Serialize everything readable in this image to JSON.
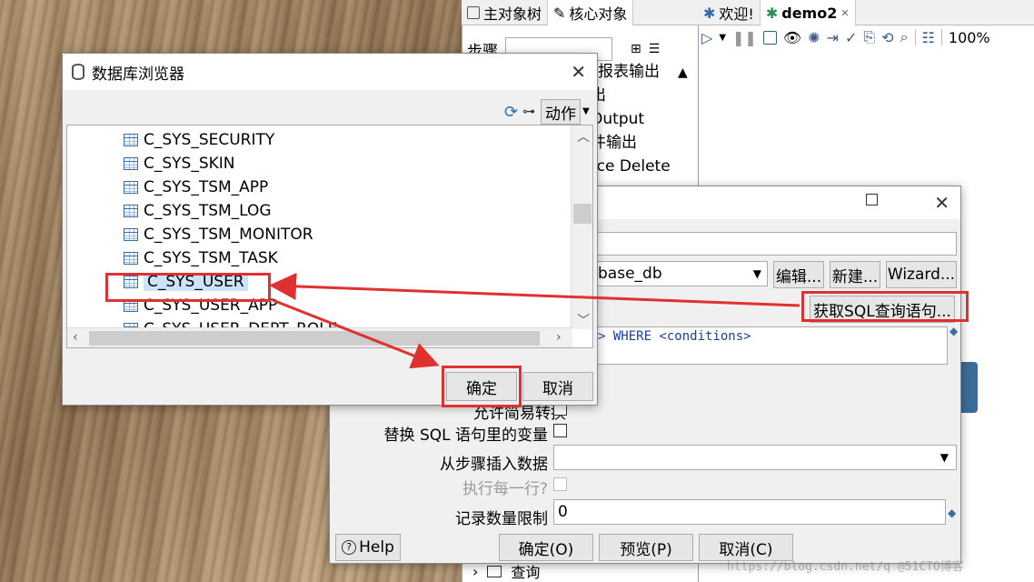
{
  "app": {
    "left_tabs": [
      "主对象树",
      "核心对象"
    ],
    "right_tabs": [
      "欢迎!",
      "demo2"
    ],
    "zoom": "100%",
    "steps_label": "步骤",
    "tree_items": [
      "报表输出",
      "出",
      "Output",
      "件输出",
      "rce Delete"
    ],
    "bottom_item": "查询"
  },
  "browser": {
    "title": "数据库浏览器",
    "action_button": "动作",
    "items": [
      "C_SYS_SECURITY",
      "C_SYS_SKIN",
      "C_SYS_TSM_APP",
      "C_SYS_TSM_LOG",
      "C_SYS_TSM_MONITOR",
      "C_SYS_TSM_TASK",
      "C_SYS_USER",
      "C_SYS_USER_APP",
      "C_SYS_USER_DEPT_ROLE"
    ],
    "selected_index": 6,
    "ok": "确定",
    "cancel": "取消"
  },
  "sql_dialog": {
    "connection_value": "base_db",
    "edit_button": "编辑...",
    "new_button": "新建...",
    "wizard_button": "Wizard...",
    "get_sql_button": "获取SQL查询语句...",
    "sql_text": "> WHERE <conditions>",
    "lazy_conversion_label": "允许简易转换",
    "replace_vars_label": "替换 SQL 语句里的变量",
    "insert_from_step_label": "从步骤插入数据",
    "execute_each_row_label": "执行每一行?",
    "limit_label": "记录数量限制",
    "limit_value": "0",
    "help_button": "Help",
    "ok_button": "确定(O)",
    "preview_button": "预览(P)",
    "cancel_button": "取消(C)"
  },
  "watermark": "https://blog.csdn.net/q @51CTO博客",
  "colors": {
    "annotation": "#e03030",
    "selection": "#cce4f7",
    "accent_green": "#2e8b57"
  }
}
